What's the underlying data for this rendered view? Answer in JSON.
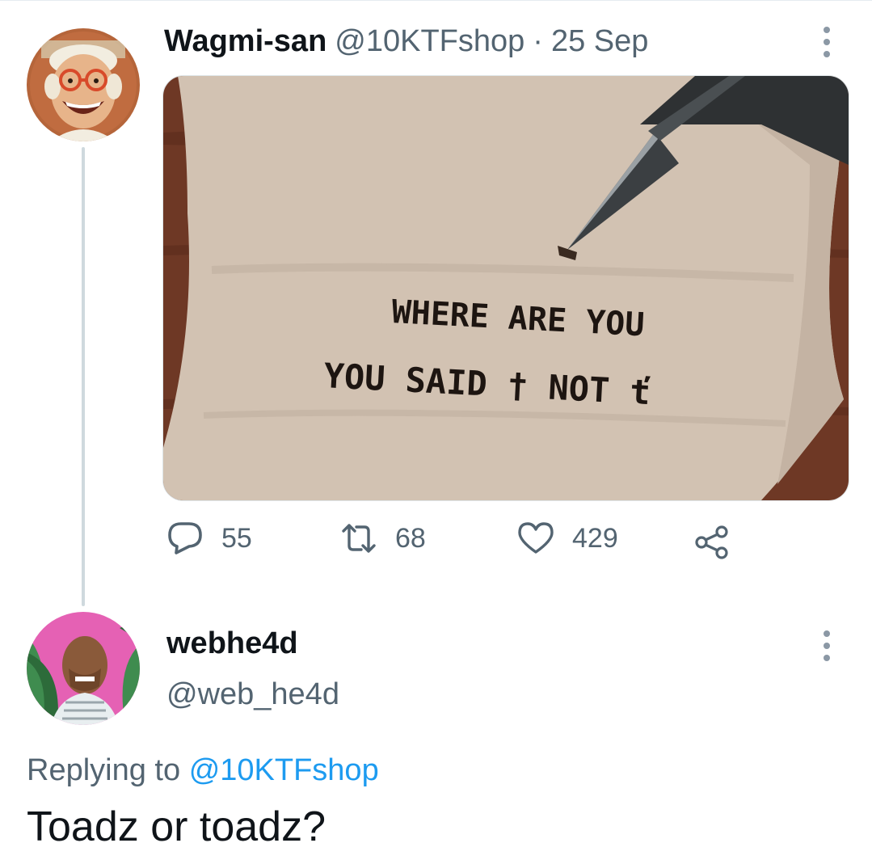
{
  "tweet": {
    "author_name": "Wagmi-san",
    "author_handle": "@10KTFshop",
    "separator": "·",
    "date": "25 Sep",
    "media_text": {
      "line1": "WHERE ARE YOU",
      "line2": "YOU SAID † NOT ť"
    },
    "actions": {
      "replies": "55",
      "retweets": "68",
      "likes": "429"
    },
    "icons": [
      "reply-icon",
      "retweet-icon",
      "like-icon",
      "share-icon",
      "more-icon"
    ]
  },
  "reply": {
    "author_name": "webhe4d",
    "author_handle": "@web_he4d",
    "replying_prefix": "Replying to",
    "replying_to": "@10KTFshop",
    "text": "Toadz or toadz?"
  },
  "colors": {
    "link": "#1d9bf0",
    "secondary_text": "#536471",
    "thread_line": "#cfd9de"
  }
}
